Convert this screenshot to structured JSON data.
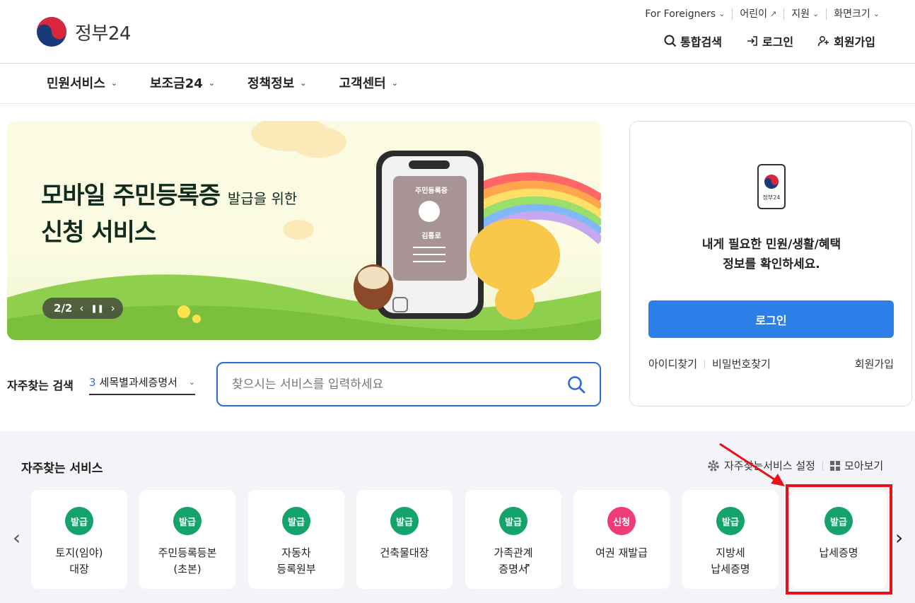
{
  "header": {
    "logo_text": "정부24",
    "util_links": [
      "For Foreigners",
      "어린이",
      "지원",
      "화면크기"
    ],
    "actions": [
      "통합검색",
      "로그인",
      "회원가입"
    ]
  },
  "gnb": [
    "민원서비스",
    "보조금24",
    "정책정보",
    "고객센터"
  ],
  "banner": {
    "title_line1": "모바일 주민등록증",
    "title_small": "발급을 위한",
    "title_line2": "신청 서비스",
    "card_title": "주민등록증",
    "card_name": "김통로",
    "pager_current": "2",
    "pager_total": "2"
  },
  "search": {
    "label": "자주찾는 검색",
    "selected_num": "3",
    "selected_text": "세목별과세증명서",
    "placeholder": "찾으시는 서비스를 입력하세요"
  },
  "login_card": {
    "icon_text": "정부24",
    "message_line1": "내게 필요한 민원/생활/혜택",
    "message_line2": "정보를 확인하세요.",
    "button": "로그인",
    "link_find_id": "아이디찾기",
    "link_find_pw": "비밀번호찾기",
    "link_join": "회원가입"
  },
  "services": {
    "title": "자주찾는 서비스",
    "settings": "자주찾는서비스 설정",
    "view_all": "모아보기",
    "items": [
      {
        "badge": "발급",
        "label": "토지(임야)\n대장"
      },
      {
        "badge": "발급",
        "label": "주민등록등본\n(초본)"
      },
      {
        "badge": "발급",
        "label": "자동차\n등록원부"
      },
      {
        "badge": "발급",
        "label": "건축물대장"
      },
      {
        "badge": "발급",
        "label": "가족관계\n증명서"
      },
      {
        "badge": "신청",
        "label": "여권 재발급"
      },
      {
        "badge": "발급",
        "label": "지방세\n납세증명"
      },
      {
        "badge": "발급",
        "label": "납세증명"
      }
    ]
  },
  "colors": {
    "primary": "#2c7ee8",
    "issue_badge": "#14a36a",
    "apply_badge": "#ee3b7a",
    "highlight": "#e8101a"
  }
}
